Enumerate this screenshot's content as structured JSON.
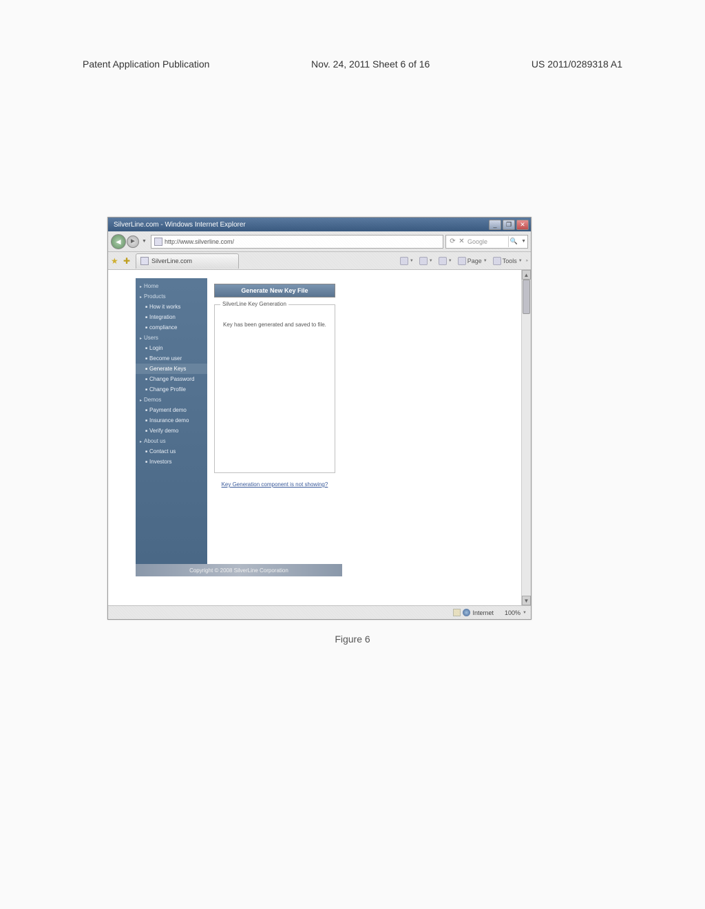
{
  "doc": {
    "header_left": "Patent Application Publication",
    "header_center": "Nov. 24, 2011  Sheet 6 of 16",
    "header_right": "US 2011/0289318 A1",
    "figure_caption": "Figure 6"
  },
  "window": {
    "title": "SilverLine.com - Windows Internet Explorer"
  },
  "nav": {
    "url": "http://www.silverline.com/",
    "search_placeholder": "Google"
  },
  "tab": {
    "label": "SilverLine.com"
  },
  "toolbar": {
    "page_label": "Page",
    "tools_label": "Tools"
  },
  "sidebar": {
    "groups": [
      {
        "label": "Home",
        "items": []
      },
      {
        "label": "Products",
        "items": [
          "How it works",
          "Integration",
          "compliance"
        ]
      },
      {
        "label": "Users",
        "items": [
          "Login",
          "Become user",
          "Generate Keys",
          "Change Password",
          "Change Profile"
        ]
      },
      {
        "label": "Demos",
        "items": [
          "Payment demo",
          "Insurance demo",
          "Verify demo"
        ]
      },
      {
        "label": "About us",
        "items": [
          "Contact us",
          "Investors"
        ]
      }
    ]
  },
  "panel": {
    "header": "Generate New Key File",
    "legend": "SilverLine Key Generation",
    "message": "Key has been generated and saved to file.",
    "help_link": "Key Generation component is not showing?"
  },
  "footer": {
    "copyright": "Copyright © 2008 SilverLine Corporation"
  },
  "status": {
    "zone": "Internet",
    "zoom": "100%"
  }
}
